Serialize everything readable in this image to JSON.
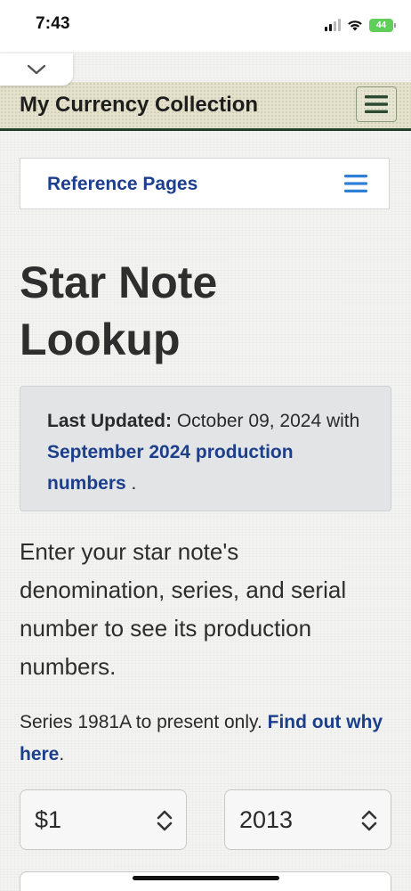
{
  "status_bar": {
    "time": "7:43",
    "battery_label": "44"
  },
  "site": {
    "title": "My Currency Collection"
  },
  "reference_nav": {
    "label": "Reference Pages"
  },
  "page": {
    "title": "Star Note Lookup",
    "update": {
      "prefix": "Last Updated:",
      "date_text": " October 09, 2024 with ",
      "link_text": "September 2024 production numbers",
      "suffix": " ."
    },
    "intro": "Enter your star note's denomination, series, and serial number to see its production numbers.",
    "series_note": {
      "text": "Series 1981A to present only. ",
      "link_text": "Find out why here",
      "suffix": "."
    }
  },
  "form": {
    "denomination": {
      "selected": "$1"
    },
    "series": {
      "selected": "2013"
    }
  },
  "colors": {
    "link": "#1c3f8c",
    "header_border": "#25402a",
    "menu_icon_green": "#2c4a2f",
    "menu_icon_blue": "#2e7fd6",
    "battery": "#5fcf5a"
  },
  "icons": {
    "collapse": "chevron-down-icon",
    "site_menu": "hamburger-menu-icon",
    "reference_menu": "hamburger-menu-icon",
    "select": "up-down-chevron-icon"
  }
}
